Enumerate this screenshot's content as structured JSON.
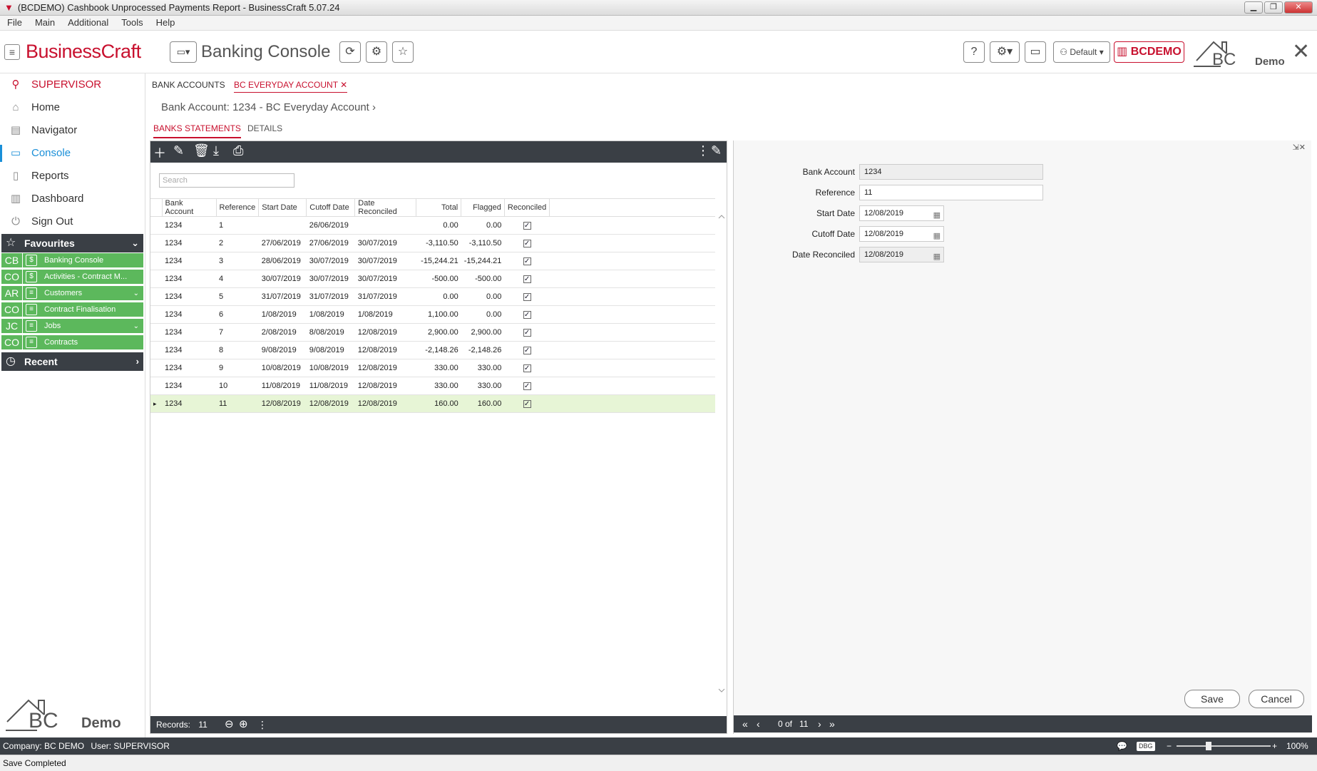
{
  "window": {
    "title": "(BCDEMO) Cashbook Unprocessed Payments Report - BusinessCraft  5.07.24",
    "menu": [
      "File",
      "Main",
      "Additional",
      "Tools",
      "Help"
    ]
  },
  "header": {
    "brand_prefix": "Business",
    "brand_suffix": "Craft",
    "console_title": "Banking Console",
    "layout_label": "Default",
    "company_code": "BCDEMO",
    "logo_text": "Demo",
    "logo_mark": "BC"
  },
  "sidebar": {
    "user": "SUPERVISOR",
    "items": [
      {
        "label": "Home",
        "icon": "home-icon"
      },
      {
        "label": "Navigator",
        "icon": "map-icon"
      },
      {
        "label": "Console",
        "icon": "console-icon"
      },
      {
        "label": "Reports",
        "icon": "document-icon"
      },
      {
        "label": "Dashboard",
        "icon": "chart-icon"
      },
      {
        "label": "Sign Out",
        "icon": "power-icon"
      }
    ],
    "favourites_label": "Favourites",
    "favourites": [
      {
        "code": "CB",
        "label": "Banking Console"
      },
      {
        "code": "CO",
        "label": "Activities - Contract M..."
      },
      {
        "code": "AR",
        "label": "Customers"
      },
      {
        "code": "CO",
        "label": "Contract Finalisation"
      },
      {
        "code": "JC",
        "label": "Jobs"
      },
      {
        "code": "CO",
        "label": "Contracts"
      }
    ],
    "recent_label": "Recent",
    "logo_text": "Demo",
    "logo_mark": "BC"
  },
  "tabs": {
    "bank_accounts": "BANK ACCOUNTS",
    "everyday": "BC EVERYDAY ACCOUNT",
    "breadcrumb": "Bank Account: 1234 - BC Everyday Account",
    "statements": "BANKS STATEMENTS",
    "details": "DETAILS"
  },
  "grid": {
    "search_placeholder": "Search",
    "columns": [
      "Bank Account",
      "Reference",
      "Start Date",
      "Cutoff Date",
      "Date Reconciled",
      "Total",
      "Flagged",
      "Reconciled"
    ],
    "rows": [
      [
        "1234",
        "1",
        "",
        "26/06/2019",
        "",
        "0.00",
        "0.00"
      ],
      [
        "1234",
        "2",
        "27/06/2019",
        "27/06/2019",
        "30/07/2019",
        "-3,110.50",
        "-3,110.50"
      ],
      [
        "1234",
        "3",
        "28/06/2019",
        "30/07/2019",
        "30/07/2019",
        "-15,244.21",
        "-15,244.21"
      ],
      [
        "1234",
        "4",
        "30/07/2019",
        "30/07/2019",
        "30/07/2019",
        "-500.00",
        "-500.00"
      ],
      [
        "1234",
        "5",
        "31/07/2019",
        "31/07/2019",
        "31/07/2019",
        "0.00",
        "0.00"
      ],
      [
        "1234",
        "6",
        "1/08/2019",
        "1/08/2019",
        "1/08/2019",
        "1,100.00",
        "0.00"
      ],
      [
        "1234",
        "7",
        "2/08/2019",
        "8/08/2019",
        "12/08/2019",
        "2,900.00",
        "2,900.00"
      ],
      [
        "1234",
        "8",
        "9/08/2019",
        "9/08/2019",
        "12/08/2019",
        "-2,148.26",
        "-2,148.26"
      ],
      [
        "1234",
        "9",
        "10/08/2019",
        "10/08/2019",
        "12/08/2019",
        "330.00",
        "330.00"
      ],
      [
        "1234",
        "10",
        "11/08/2019",
        "11/08/2019",
        "12/08/2019",
        "330.00",
        "330.00"
      ],
      [
        "1234",
        "11",
        "12/08/2019",
        "12/08/2019",
        "12/08/2019",
        "160.00",
        "160.00"
      ]
    ],
    "selected_row": 10,
    "records_label": "Records:",
    "records_count": "11"
  },
  "detail": {
    "fields": [
      {
        "label": "Bank Account",
        "value": "1234"
      },
      {
        "label": "Reference",
        "value": "11"
      },
      {
        "label": "Start Date",
        "value": "12/08/2019"
      },
      {
        "label": "Cutoff Date",
        "value": "12/08/2019"
      },
      {
        "label": "Date Reconciled",
        "value": "12/08/2019"
      }
    ],
    "save_label": "Save",
    "cancel_label": "Cancel",
    "nav_position": "0 of",
    "nav_total": "11"
  },
  "status": {
    "company_label": "Company:",
    "company": "BC DEMO",
    "user_label": "User:",
    "user": "SUPERVISOR",
    "dbg": "DBG",
    "zoom": "100%",
    "message": "Save Completed"
  },
  "colors": {
    "brand": "#c8102e",
    "accent": "#1a8fd8",
    "favourite_green": "#5cb85c",
    "dark_bar": "#3a3f45"
  }
}
